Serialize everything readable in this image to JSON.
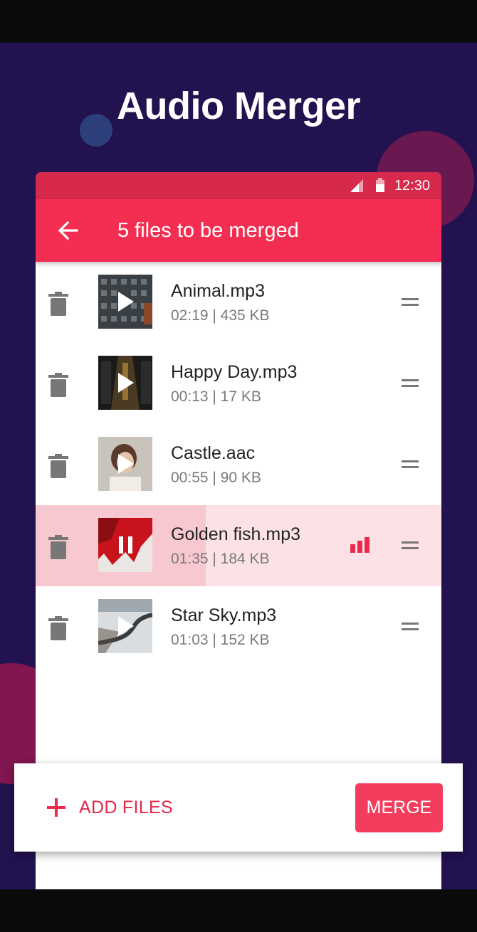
{
  "promo": {
    "title": "Audio Merger"
  },
  "status_bar": {
    "time": "12:30"
  },
  "appbar": {
    "title": "5 files to be merged"
  },
  "files": [
    {
      "name": "Animal.mp3",
      "meta": "02:19 | 435 KB",
      "state": "stopped"
    },
    {
      "name": "Happy Day.mp3",
      "meta": "00:13 | 17 KB",
      "state": "stopped"
    },
    {
      "name": "Castle.aac",
      "meta": "00:55 | 90 KB",
      "state": "stopped"
    },
    {
      "name": "Golden fish.mp3",
      "meta": "01:35 | 184 KB",
      "state": "playing",
      "progress": 0.42
    },
    {
      "name": "Star Sky.mp3",
      "meta": "01:03 | 152 KB",
      "state": "stopped"
    }
  ],
  "actions": {
    "add_files": "ADD FILES",
    "merge": "MERGE"
  },
  "colors": {
    "background": "#22124f",
    "accent": "#f42e52",
    "status": "#d6294b",
    "active_row": "#fce2e6"
  }
}
